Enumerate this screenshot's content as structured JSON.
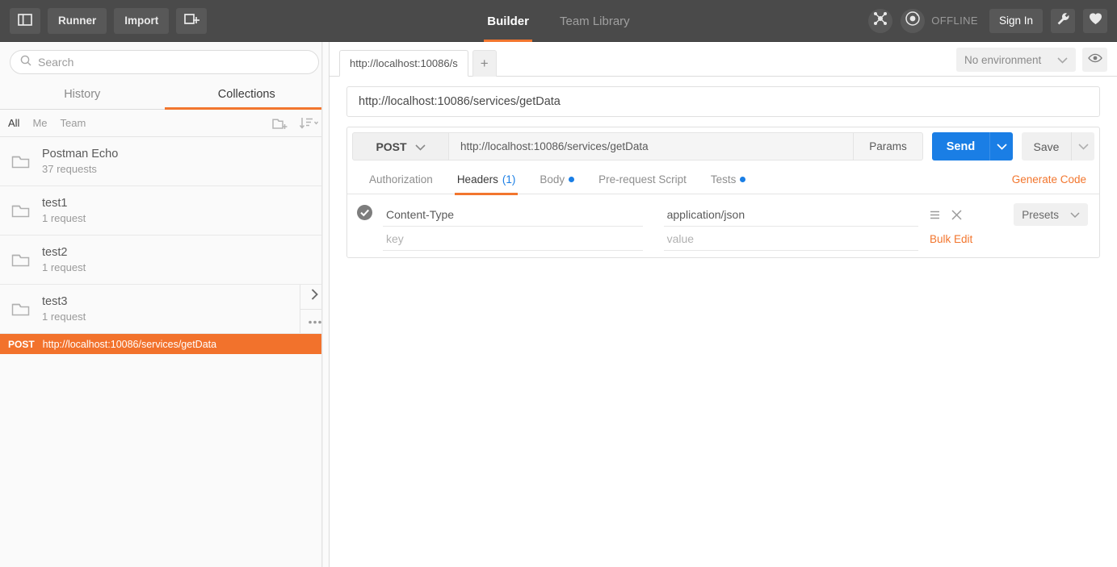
{
  "topbar": {
    "sidebar_toggle_icon": "sidebar-toggle-icon",
    "runner_label": "Runner",
    "import_label": "Import",
    "new_tab_icon": "new-window-icon",
    "tabs": [
      {
        "label": "Builder",
        "active": true
      },
      {
        "label": "Team Library",
        "active": false
      }
    ],
    "sync_icon": "network-sync-icon",
    "status_icon": "offline-status-icon",
    "status_label": "OFFLINE",
    "signin_label": "Sign In",
    "wrench_icon": "wrench-icon",
    "heart_icon": "heart-icon"
  },
  "sidebar": {
    "search": {
      "value": "",
      "placeholder": "Search",
      "icon": "search-icon"
    },
    "tabs": [
      {
        "label": "History",
        "active": false
      },
      {
        "label": "Collections",
        "active": true
      }
    ],
    "filters": [
      {
        "label": "All",
        "active": true
      },
      {
        "label": "Me",
        "active": false
      },
      {
        "label": "Team",
        "active": false
      }
    ],
    "new_collection_icon": "new-collection-icon",
    "sort_icon": "sort-icon",
    "collections": [
      {
        "name": "Postman Echo",
        "count": "37 requests",
        "icon": "folder-icon"
      },
      {
        "name": "test1",
        "count": "1 request",
        "icon": "folder-icon"
      },
      {
        "name": "test2",
        "count": "1 request",
        "icon": "folder-icon"
      },
      {
        "name": "test3",
        "count": "1 request",
        "icon": "folder-icon"
      }
    ],
    "selected_request": {
      "method": "POST",
      "url": "http://localhost:10086/services/getData"
    },
    "expand_icon": "chevron-right-icon",
    "more_icon": "more-options-icon"
  },
  "main": {
    "request_tabs": [
      {
        "label": "http://localhost:10086/s",
        "active": true
      }
    ],
    "add_tab_label": "+",
    "environment": {
      "label": "No environment",
      "caret_icon": "chevron-down-icon"
    },
    "eye_icon": "eye-icon",
    "request_title": "http://localhost:10086/services/getData",
    "method": "POST",
    "method_caret_icon": "chevron-down-icon",
    "url": "http://localhost:10086/services/getData",
    "params_label": "Params",
    "send_label": "Send",
    "send_caret_icon": "chevron-down-icon",
    "save_label": "Save",
    "save_caret_icon": "chevron-down-icon",
    "subtabs": [
      {
        "label": "Authorization",
        "active": false,
        "count": "",
        "dot": false
      },
      {
        "label": "Headers",
        "active": true,
        "count": "(1)",
        "dot": false
      },
      {
        "label": "Body",
        "active": false,
        "count": "",
        "dot": true
      },
      {
        "label": "Pre-request Script",
        "active": false,
        "count": "",
        "dot": false
      },
      {
        "label": "Tests",
        "active": false,
        "count": "",
        "dot": true
      }
    ],
    "generate_code_label": "Generate Code",
    "headers_table": {
      "rows": [
        {
          "checked": true,
          "key": "Content-Type",
          "value": "application/json"
        }
      ],
      "key_placeholder": "key",
      "value_placeholder": "value",
      "reorder_icon": "reorder-icon",
      "delete_icon": "close-icon",
      "presets_label": "Presets",
      "presets_caret_icon": "chevron-down-icon",
      "bulk_edit_label": "Bulk Edit"
    }
  },
  "colors": {
    "accent_orange": "#f2762e",
    "accent_blue": "#1a7ee5",
    "header_bg": "#4a4a4a",
    "selected_request_bg": "#f2722c"
  }
}
